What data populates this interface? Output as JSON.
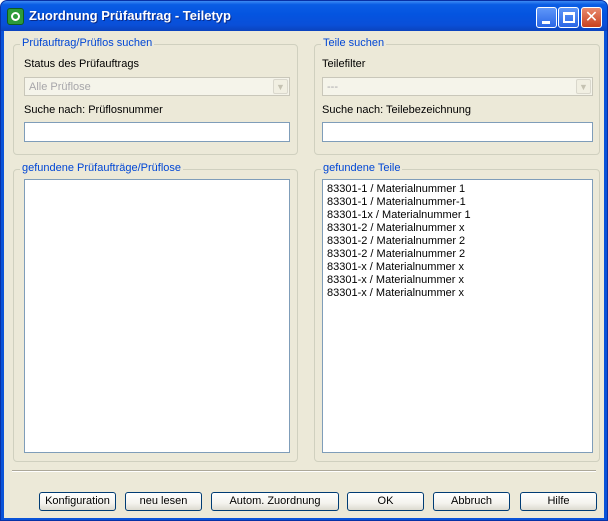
{
  "window": {
    "title": "Zuordnung Prüfauftrag - Teiletyp",
    "icon": "app-icon",
    "controls": {
      "minimize": "minimize-icon",
      "maximize": "maximize-icon",
      "close": "✕"
    }
  },
  "left_search": {
    "legend": "Prüfauftrag/Prüflos suchen",
    "status_label": "Status des Prüfauftrags",
    "status_value": "Alle Prüflose",
    "search_label": "Suche nach: Prüflosnummer",
    "search_value": ""
  },
  "right_search": {
    "legend": "Teile suchen",
    "filter_label": "Teilefilter",
    "filter_value": "---",
    "search_label": "Suche nach: Teilebezeichnung",
    "search_value": ""
  },
  "left_results": {
    "legend": "gefundene Prüfaufträge/Prüflose",
    "items": []
  },
  "right_results": {
    "legend": "gefundene Teile",
    "items": [
      "83301-1 / Materialnummer 1",
      "83301-1 / Materialnummer-1",
      "83301-1x / Materialnummer 1",
      "83301-2 / Materialnummer x",
      "83301-2 / Materialnummer 2",
      "83301-2 / Materialnummer 2",
      "83301-x / Materialnummer x",
      "83301-x / Materialnummer x",
      "83301-x / Materialnummer x"
    ]
  },
  "buttons": {
    "config": "Konfiguration",
    "reload": "neu lesen",
    "auto_assign": "Autom. Zuordnung",
    "ok": "OK",
    "cancel": "Abbruch",
    "help": "Hilfe"
  },
  "colors": {
    "titlebar": "#0454e0",
    "client_background": "#ece9d8",
    "legend_text": "#0046d5"
  }
}
